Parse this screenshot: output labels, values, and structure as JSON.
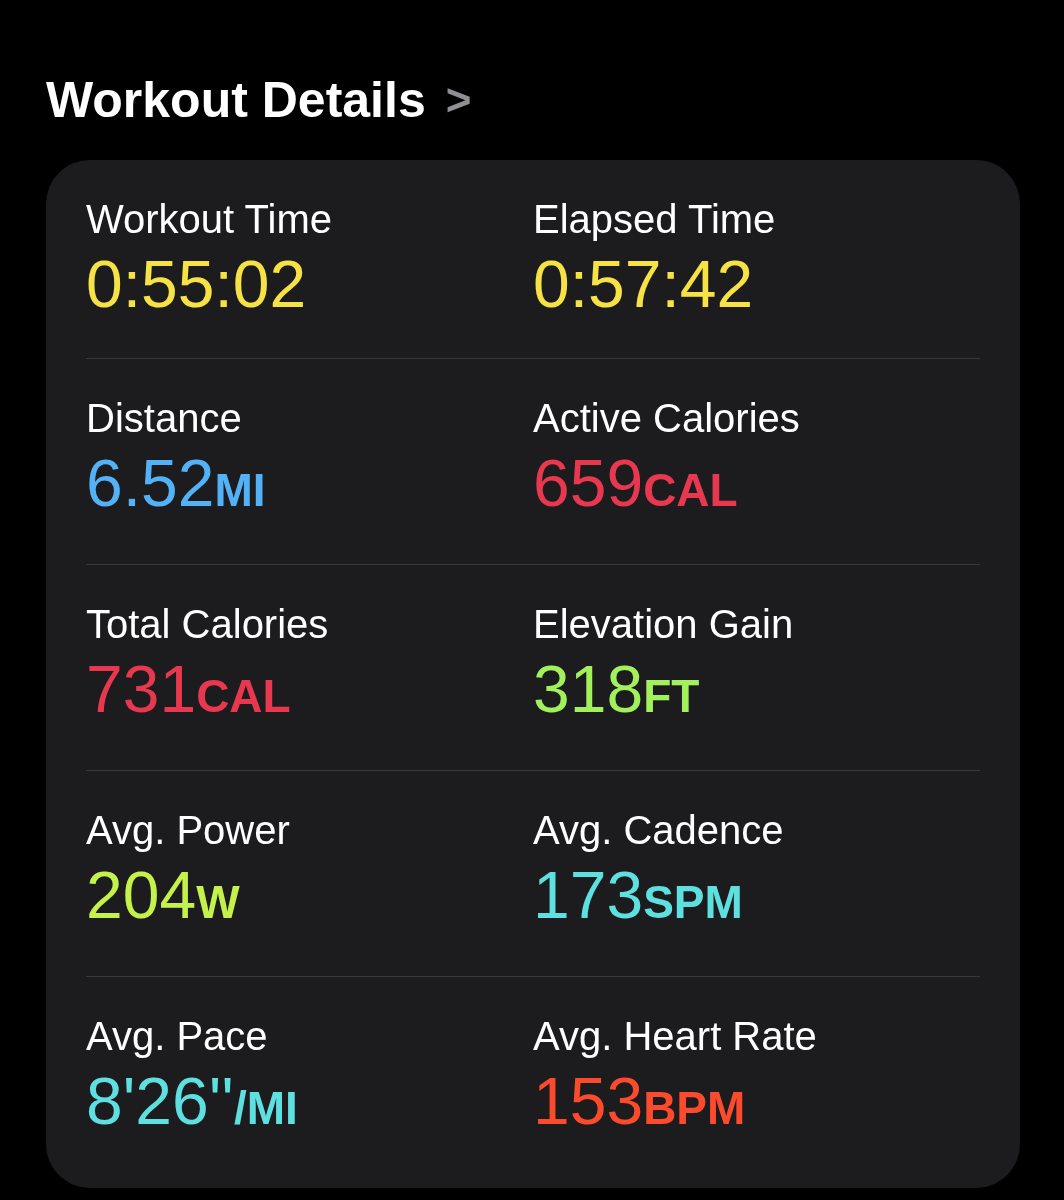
{
  "header": {
    "title": "Workout Details",
    "chevron": ">"
  },
  "metrics": [
    {
      "label": "Workout Time",
      "value": "0:55:02",
      "color": "#f6e244"
    },
    {
      "label": "Elapsed Time",
      "value": "0:57:42",
      "color": "#f6e244"
    },
    {
      "label": "Distance",
      "value": "6.52",
      "unit": "MI",
      "color": "#52b2f5"
    },
    {
      "label": "Active Calories",
      "value": "659",
      "unit": "CAL",
      "color": "#e8384f"
    },
    {
      "label": "Total Calories",
      "value": "731",
      "unit": "CAL",
      "color": "#e8384f"
    },
    {
      "label": "Elevation Gain",
      "value": "318",
      "unit": "FT",
      "color": "#a2f05c"
    },
    {
      "label": "Avg. Power",
      "value": "204",
      "unit": "W",
      "color": "#c4f24a"
    },
    {
      "label": "Avg. Cadence",
      "value": "173",
      "unit": "SPM",
      "color": "#5ee0e0"
    },
    {
      "label": "Avg. Pace",
      "value": "8'26''",
      "unit": "/MI",
      "color": "#5ee0e0"
    },
    {
      "label": "Avg. Heart Rate",
      "value": "153",
      "unit": "BPM",
      "color": "#fb4a2c"
    }
  ]
}
